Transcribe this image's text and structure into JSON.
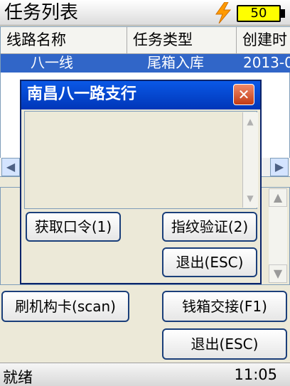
{
  "window": {
    "title": "任务列表"
  },
  "battery": {
    "level": "50",
    "charging": true
  },
  "table": {
    "columns": [
      "线路名称",
      "任务类型",
      "创建时"
    ],
    "rows": [
      {
        "line_name": "八一线",
        "task_type": "尾箱入库",
        "created": "2013-0"
      }
    ]
  },
  "buttons": {
    "scan_card": "刷机构卡(scan)",
    "cash_box_handover": "钱箱交接(F1)",
    "exit": "退出(ESC)"
  },
  "dialog": {
    "title": "南昌八一路支行",
    "close": "✕",
    "get_password": "获取口令(1)",
    "fingerprint_verify": "指纹验证(2)",
    "exit": "退出(ESC)"
  },
  "statusbar": {
    "status": "就绪",
    "time": "11:05"
  },
  "colors": {
    "selection": "#3166c8",
    "dialog_title": "#0036b8",
    "battery": "#ffff00",
    "close_button": "#c23b14"
  },
  "icons": {
    "charging": "lightning-bolt-icon",
    "battery": "battery-icon",
    "scroll_left": "chevron-left-icon",
    "scroll_right": "chevron-right-icon",
    "scroll_up": "chevron-up-icon",
    "scroll_down": "chevron-down-icon",
    "close": "close-icon"
  }
}
